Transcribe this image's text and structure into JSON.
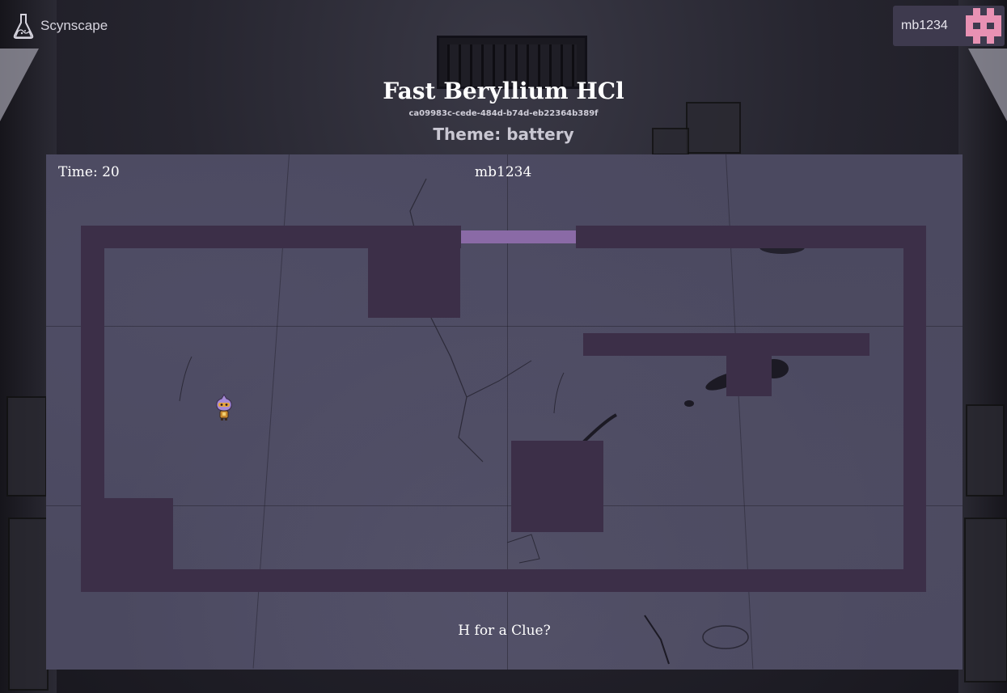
{
  "brand": {
    "name": "Scynscape",
    "icon": "flask-icon"
  },
  "user": {
    "username": "mb1234",
    "avatar_color": "#e891b3"
  },
  "game": {
    "title": "Fast Beryllium HCl",
    "id": "ca09983c-cede-484d-b74d-eb22364b389f",
    "theme": "Theme: battery"
  },
  "hud": {
    "time": "Time: 20",
    "player": "mb1234",
    "hint": "H for a Clue?"
  },
  "colors": {
    "wall": "#3c2f48",
    "door": "#8a6aa6",
    "floor": "#4b4960"
  }
}
